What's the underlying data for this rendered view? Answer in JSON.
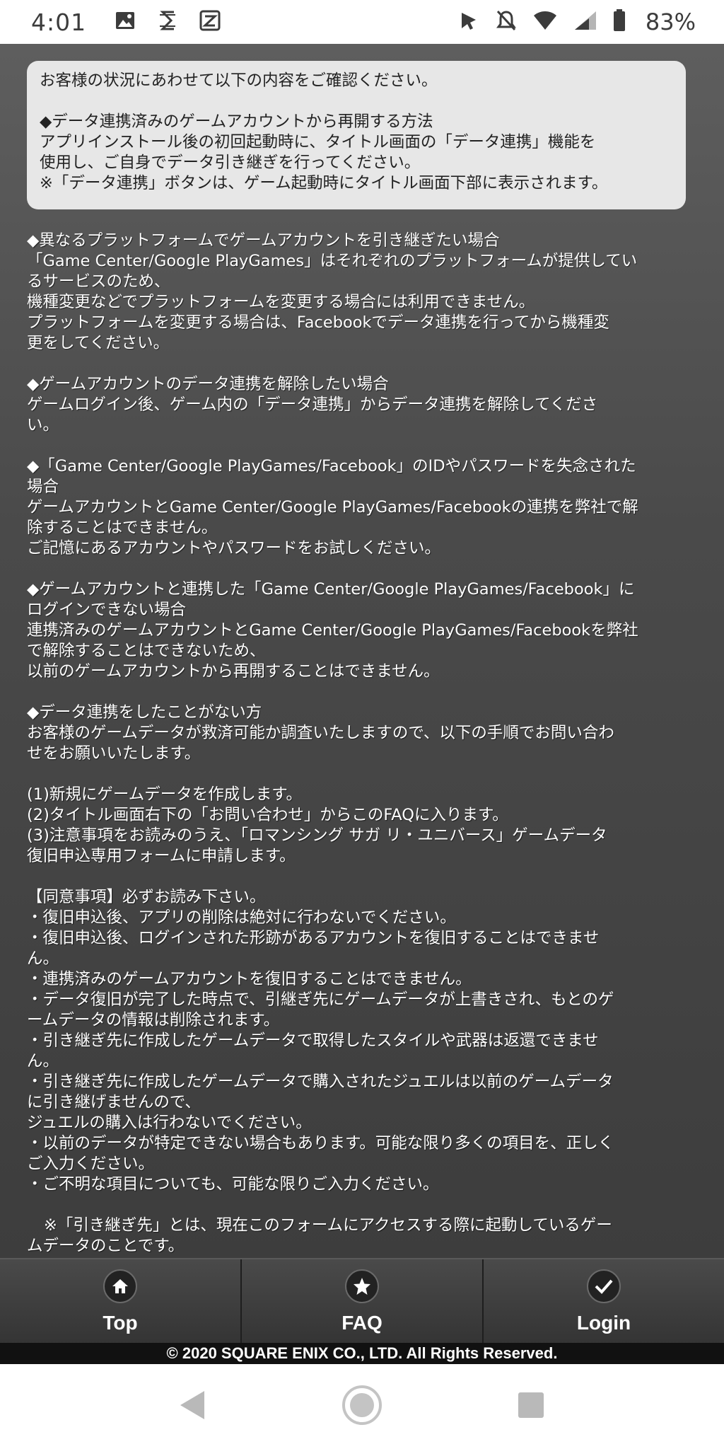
{
  "status_bar": {
    "time": "4:01",
    "battery_percent": "83%"
  },
  "notice": {
    "lines": [
      "お客様の状況にあわせて以下の内容をご確認ください。",
      "",
      "◆データ連携済みのゲームアカウントから再開する方法",
      "アプリインストール後の初回起動時に、タイトル画面の「データ連携」機能を",
      "使用し、ご自身でデータ引き継ぎを行ってください。",
      "※「データ連携」ボタンは、ゲーム起動時にタイトル画面下部に表示されます。"
    ]
  },
  "main": {
    "lines": [
      "◆異なるプラットフォームでゲームアカウントを引き継ぎたい場合",
      "「Game Center/Google PlayGames」はそれぞれのプラットフォームが提供してい",
      "るサービスのため、",
      "機種変更などでプラットフォームを変更する場合には利用できません。",
      "プラットフォームを変更する場合は、Facebookでデータ連携を行ってから機種変",
      "更をしてください。",
      "",
      "◆ゲームアカウントのデータ連携を解除したい場合",
      "ゲームログイン後、ゲーム内の「データ連携」からデータ連携を解除してくださ",
      "い。",
      "",
      "◆「Game Center/Google PlayGames/Facebook」のIDやパスワードを失念された",
      "場合",
      "ゲームアカウントとGame Center/Google PlayGames/Facebookの連携を弊社で解",
      "除することはできません。",
      "ご記憶にあるアカウントやパスワードをお試しください。",
      "",
      "◆ゲームアカウントと連携した「Game Center/Google PlayGames/Facebook」に",
      "ログインできない場合",
      "連携済みのゲームアカウントとGame Center/Google PlayGames/Facebookを弊社",
      "で解除することはできないため、",
      "以前のゲームアカウントから再開することはできません。",
      "",
      "◆データ連携をしたことがない方",
      "お客様のゲームデータが救済可能か調査いたしますので、以下の手順でお問い合わ",
      "せをお願いいたします。",
      "",
      "(1)新規にゲームデータを作成します。",
      "(2)タイトル画面右下の「お問い合わせ」からこのFAQに入ります。",
      "(3)注意事項をお読みのうえ、「ロマンシング サガ リ・ユニバース」ゲームデータ",
      "復旧申込専用フォームに申請します。",
      "",
      "【同意事項】必ずお読み下さい。",
      "・復旧申込後、アプリの削除は絶対に行わないでください。",
      "・復旧申込後、ログインされた形跡があるアカウントを復旧することはできませ",
      "ん。",
      "・連携済みのゲームアカウントを復旧することはできません。",
      "・データ復旧が完了した時点で、引継ぎ先にゲームデータが上書きされ、もとのゲ",
      "ームデータの情報は削除されます。",
      "・引き継ぎ先に作成したゲームデータで取得したスタイルや武器は返還できませ",
      "ん。",
      "・引き継ぎ先に作成したゲームデータで購入されたジュエルは以前のゲームデータ",
      "に引き継げませんので、",
      "ジュエルの購入は行わないでください。",
      "・以前のデータが特定できない場合もあります。可能な限り多くの項目を、正しく",
      "ご入力ください。",
      "・ご不明な項目についても、可能な限りご入力ください。",
      "",
      "※「引き継ぎ先」とは、現在このフォームにアクセスする際に起動しているゲー",
      "ムデータのことです。"
    ]
  },
  "bottom_nav": {
    "items": [
      {
        "label": "Top",
        "icon": "home-icon"
      },
      {
        "label": "FAQ",
        "icon": "star-icon"
      },
      {
        "label": "Login",
        "icon": "checkmark-icon"
      }
    ]
  },
  "footer": {
    "copyright": "© 2020 SQUARE ENIX CO., LTD. All Rights Reserved."
  }
}
